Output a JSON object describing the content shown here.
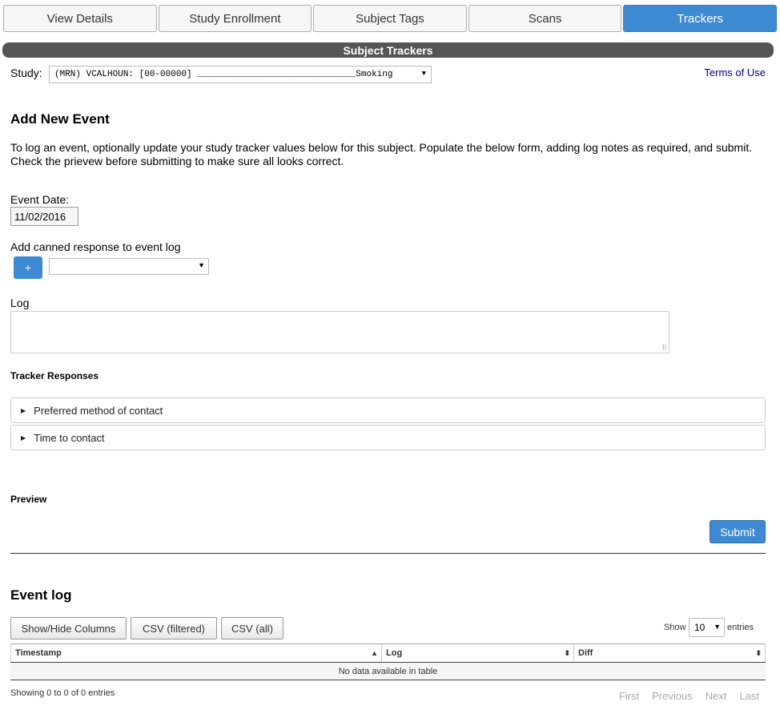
{
  "tabs": [
    {
      "label": "View Details",
      "active": false
    },
    {
      "label": "Study Enrollment",
      "active": false
    },
    {
      "label": "Subject Tags",
      "active": false
    },
    {
      "label": "Scans",
      "active": false
    },
    {
      "label": "Trackers",
      "active": true
    }
  ],
  "section_title": "Subject Trackers",
  "study": {
    "label": "Study:",
    "selected_value": "(MRN) VCALHOUN: [00-00000] ______________________________Smoking"
  },
  "terms_link": "Terms of Use",
  "add_event": {
    "heading": "Add New Event",
    "intro": "To log an event, optionally update your study tracker values below for this subject. Populate the below form, adding log notes as required, and submit. Check the prievew before submitting to make sure all looks correct.",
    "event_date_label": "Event Date:",
    "event_date_value": "11/02/2016",
    "canned_label": "Add canned response to event log",
    "plus_label": "+",
    "canned_value": "",
    "log_label": "Log",
    "log_value": ""
  },
  "tracker_responses": {
    "heading": "Tracker Responses",
    "items": [
      "Preferred method of contact",
      "Time to contact"
    ]
  },
  "preview_heading": "Preview",
  "submit_label": "Submit",
  "event_log": {
    "heading": "Event log",
    "buttons": [
      "Show/Hide Columns",
      "CSV (filtered)",
      "CSV (all)"
    ],
    "show_label": "Show",
    "entries_value": "10",
    "entries_label": "entries",
    "columns": [
      "Timestamp",
      "Log",
      "Diff"
    ],
    "empty_message": "No data available in table",
    "info": "Showing 0 to 0 of 0 entries",
    "pager": [
      "First",
      "Previous",
      "Next",
      "Last"
    ]
  },
  "colors": {
    "accent": "#3e8ad2",
    "section_bar": "#555555",
    "link": "#00008b"
  }
}
